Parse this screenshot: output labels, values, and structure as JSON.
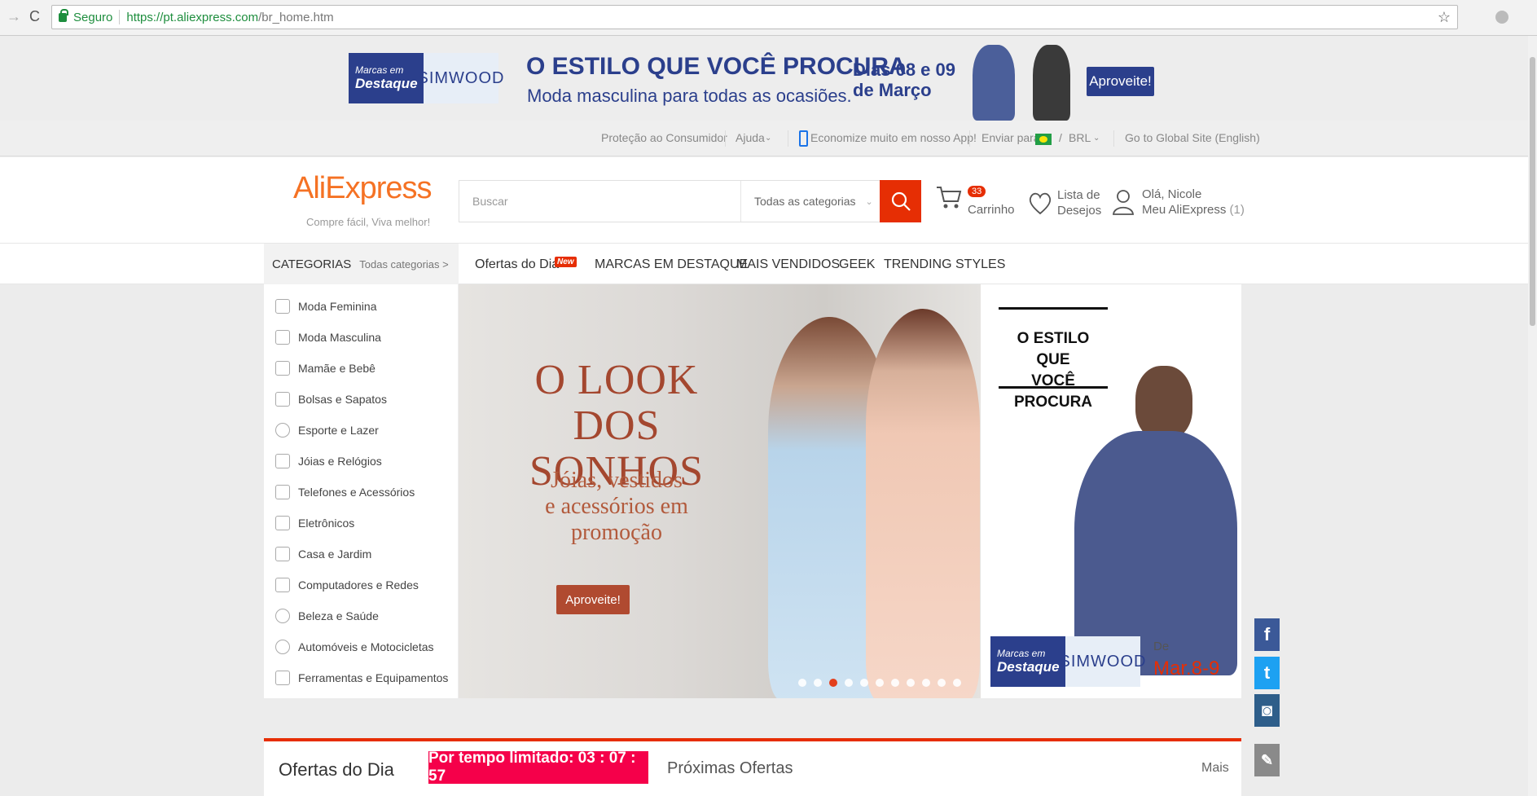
{
  "browser": {
    "back": "→",
    "reload": "C",
    "secure_label": "Seguro",
    "url_host": "https://pt.aliexpress.com",
    "url_path": "/br_home.htm",
    "star": "☆"
  },
  "promo": {
    "brand_top": "Marcas em",
    "brand_bottom": "Destaque",
    "brand_name": "SIMWOOD",
    "title": "O ESTILO QUE VOCÊ PROCURA",
    "subtitle": "Moda masculina para todas as ocasiões.",
    "dates_line1": "Dias  08 e 09",
    "dates_line2": "de Março",
    "button": "Aproveite!"
  },
  "util": {
    "consumer": "Proteção ao Consumidor",
    "help": "Ajuda",
    "app": "Economize muito em nosso App!",
    "ship_to": "Enviar para",
    "slash": "/",
    "currency": "BRL",
    "global": "Go to Global Site (English)"
  },
  "header": {
    "logo": "AliExpress",
    "tagline": "Compre fácil, Viva melhor!",
    "search_placeholder": "Buscar",
    "search_category": "Todas as categorias",
    "cart_count": "33",
    "cart_label": "Carrinho",
    "wishlist_line1": "Lista de",
    "wishlist_line2": "Desejos",
    "account_line1": "Olá, Nicole",
    "account_line2": "Meu AliExpress",
    "account_count": "(1)"
  },
  "nav": {
    "categories_title": "CATEGORIAS",
    "all_categories": "Todas categorias >",
    "links": [
      "Ofertas do Dia",
      "MARCAS EM DESTAQUE",
      "MAIS VENDIDOS",
      "GEEK",
      "TRENDING STYLES"
    ],
    "new_badge": "New"
  },
  "sidebar": {
    "items": [
      "Moda Feminina",
      "Moda Masculina",
      "Mamãe e Bebê",
      "Bolsas e Sapatos",
      "Esporte e Lazer",
      "Jóias e Relógios",
      "Telefones e Acessórios",
      "Eletrônicos",
      "Casa e Jardim",
      "Computadores e Redes",
      "Beleza e Saúde",
      "Automóveis e Motocicletas",
      "Ferramentas e Equipamentos"
    ]
  },
  "hero": {
    "title_line1": "O LOOK DOS",
    "title_line2": "SONHOS",
    "sub_line1": "Jóias, vestidos",
    "sub_line2": "e acessórios em",
    "sub_line3": "promoção",
    "button": "Aproveite!",
    "slides": 11,
    "active_slide": 3
  },
  "right_banner": {
    "title_line1": "O ESTILO QUE",
    "title_line2": "VOCÊ PROCURA",
    "brand_top": "Marcas em",
    "brand_bottom": "Destaque",
    "brand_name": "SIMWOOD",
    "de": "De",
    "date": "Mar.8-9"
  },
  "social": {
    "facebook": "f",
    "twitter": "t",
    "instagram": "◙",
    "edit": "✎"
  },
  "deals": {
    "title": "Ofertas do Dia",
    "timer": "Por tempo limitado: 03 : 07 : 57",
    "next": "Próximas Ofertas",
    "more": "Mais"
  },
  "colors": {
    "accent": "#e62e04",
    "brand_blue": "#2b3f8c",
    "logo_orange": "#f57224",
    "timer_pink": "#f5004a"
  }
}
